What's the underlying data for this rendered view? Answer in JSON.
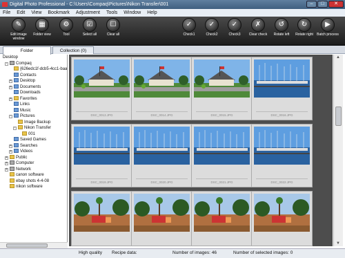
{
  "window": {
    "title": "Digital Photo Professional - C:\\Users\\Compaq\\Pictures\\Nikon Transfer\\001"
  },
  "menu": [
    "File",
    "Edit",
    "View",
    "Bookmark",
    "Adjustment",
    "Tools",
    "Window",
    "Help"
  ],
  "toolbar": {
    "left": [
      {
        "label": "Edit image window",
        "icon": "edit-image-icon"
      },
      {
        "label": "Folder view",
        "icon": "folder-view-icon"
      },
      {
        "label": "Tool",
        "icon": "tool-icon"
      },
      {
        "label": "Select all",
        "icon": "select-all-icon"
      },
      {
        "label": "Clear all",
        "icon": "clear-all-icon"
      }
    ],
    "right": [
      {
        "label": "Check1",
        "icon": "check1-icon"
      },
      {
        "label": "Check2",
        "icon": "check2-icon"
      },
      {
        "label": "Check3",
        "icon": "check3-icon"
      },
      {
        "label": "Clear check",
        "icon": "clear-check-icon"
      },
      {
        "label": "Rotate left",
        "icon": "rotate-left-icon"
      },
      {
        "label": "Rotate right",
        "icon": "rotate-right-icon"
      },
      {
        "label": "Batch process",
        "icon": "batch-process-icon"
      }
    ]
  },
  "tabs": [
    "Folder",
    "Collection (0)"
  ],
  "tree": [
    {
      "label": "Desktop",
      "indent": 0,
      "icon": "none",
      "exp": ""
    },
    {
      "label": "Compaq",
      "indent": 1,
      "icon": "comp",
      "exp": "-"
    },
    {
      "label": "{626edc1f-dcb5-4cc1-baa7-a",
      "indent": 2,
      "icon": "yellow",
      "exp": ""
    },
    {
      "label": "Contacts",
      "indent": 2,
      "icon": "blue",
      "exp": ""
    },
    {
      "label": "Desktop",
      "indent": 2,
      "icon": "blue",
      "exp": "+"
    },
    {
      "label": "Documents",
      "indent": 2,
      "icon": "blue",
      "exp": "+"
    },
    {
      "label": "Downloads",
      "indent": 2,
      "icon": "blue",
      "exp": ""
    },
    {
      "label": "Favorites",
      "indent": 2,
      "icon": "yellow",
      "exp": "+"
    },
    {
      "label": "Links",
      "indent": 2,
      "icon": "blue",
      "exp": ""
    },
    {
      "label": "Music",
      "indent": 2,
      "icon": "blue",
      "exp": ""
    },
    {
      "label": "Pictures",
      "indent": 2,
      "icon": "blue",
      "exp": "-"
    },
    {
      "label": "Image Backup",
      "indent": 3,
      "icon": "yellow",
      "exp": ""
    },
    {
      "label": "Nikon Transfer",
      "indent": 3,
      "icon": "yellow",
      "exp": "-"
    },
    {
      "label": "001",
      "indent": 4,
      "icon": "yellow",
      "exp": ""
    },
    {
      "label": "Saved Games",
      "indent": 2,
      "icon": "blue",
      "exp": ""
    },
    {
      "label": "Searches",
      "indent": 2,
      "icon": "blue",
      "exp": "+"
    },
    {
      "label": "Videos",
      "indent": 2,
      "icon": "blue",
      "exp": "+"
    },
    {
      "label": "Public",
      "indent": 1,
      "icon": "yellow",
      "exp": "+"
    },
    {
      "label": "Computer",
      "indent": 1,
      "icon": "comp",
      "exp": "+"
    },
    {
      "label": "Network",
      "indent": 1,
      "icon": "comp",
      "exp": "+"
    },
    {
      "label": "canon software",
      "indent": 1,
      "icon": "yellow",
      "exp": ""
    },
    {
      "label": "ebay shots 4-4-08",
      "indent": 1,
      "icon": "yellow",
      "exp": ""
    },
    {
      "label": "nikon software",
      "indent": 1,
      "icon": "yellow",
      "exp": ""
    }
  ],
  "thumbnails": [
    {
      "caption": "DSC_0013.JPG",
      "scene": "house"
    },
    {
      "caption": "DSC_0014.JPG",
      "scene": "house"
    },
    {
      "caption": "DSC_0015.JPG",
      "scene": "house"
    },
    {
      "caption": "DSC_0016.JPG",
      "scene": "marina"
    },
    {
      "caption": "DSC_0019.JPG",
      "scene": "marina"
    },
    {
      "caption": "DSC_0020.JPG",
      "scene": "marina"
    },
    {
      "caption": "DSC_0021.JPG",
      "scene": "marina"
    },
    {
      "caption": "DSC_0022.JPG",
      "scene": "marina"
    },
    {
      "caption": "",
      "scene": "park"
    },
    {
      "caption": "",
      "scene": "park"
    },
    {
      "caption": "",
      "scene": "park"
    },
    {
      "caption": "",
      "scene": "park"
    }
  ],
  "status": {
    "quality": "High quality",
    "recipe": "Recipe data:",
    "num_images": "Number of images: 46",
    "num_selected": "Number of selected images: 0"
  }
}
